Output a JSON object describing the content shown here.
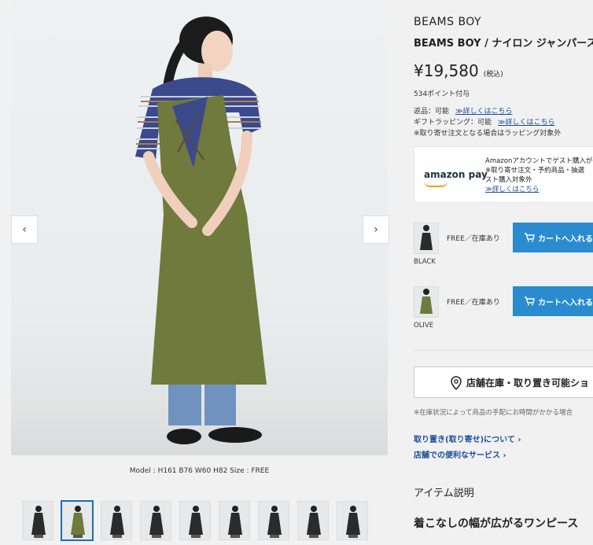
{
  "gallery": {
    "caption": "Model : H161 B76 W60 H82   Size : FREE",
    "prev_glyph": "‹",
    "next_glyph": "›",
    "thumbnail_count": 9,
    "active_thumbnail": 2
  },
  "product": {
    "brand": "BEAMS BOY",
    "title": "BEAMS BOY / ナイロン ジャンパース",
    "price": "¥19,580",
    "tax": "(税込)",
    "points": "534ポイント付与",
    "returns_label": "返品：可能",
    "returns_link": "≫詳しくはこちら",
    "wrapping_label": "ギフトラッピング：可能",
    "wrapping_link": "≫詳しくはこちら",
    "wrapping_note": "※取り寄せ注文となる場合はラッピング対象外"
  },
  "amazon_pay": {
    "logo": "amazon pay",
    "line1": "Amazonアカウントでゲスト購入が",
    "line2": "※取り寄せ注文・予約商品・抽選",
    "line3": "スト購入対象外",
    "link": "≫詳しくはこちら"
  },
  "variants": [
    {
      "name": "BLACK",
      "stock": "FREE／在庫あり",
      "button": "カートへ入れる",
      "color": "#2b2b2b"
    },
    {
      "name": "OLIVE",
      "stock": "FREE／在庫あり",
      "button": "カートへ入れる",
      "color": "#6f7a3c"
    }
  ],
  "store": {
    "button": "店舗在庫・取り置き可能ショ",
    "note": "※在庫状況によって商品の手配にお時間がかかる場合",
    "link1": "取り置き(取り寄せ)について ›",
    "link2": "店舗での便利なサービス ›"
  },
  "description": {
    "section_title": "アイテム説明",
    "headline": "着こなしの幅が広がるワンピース"
  },
  "colors": {
    "accent": "#2a8ccf",
    "link": "#1b4c9c",
    "olive": "#6f7a3c"
  }
}
